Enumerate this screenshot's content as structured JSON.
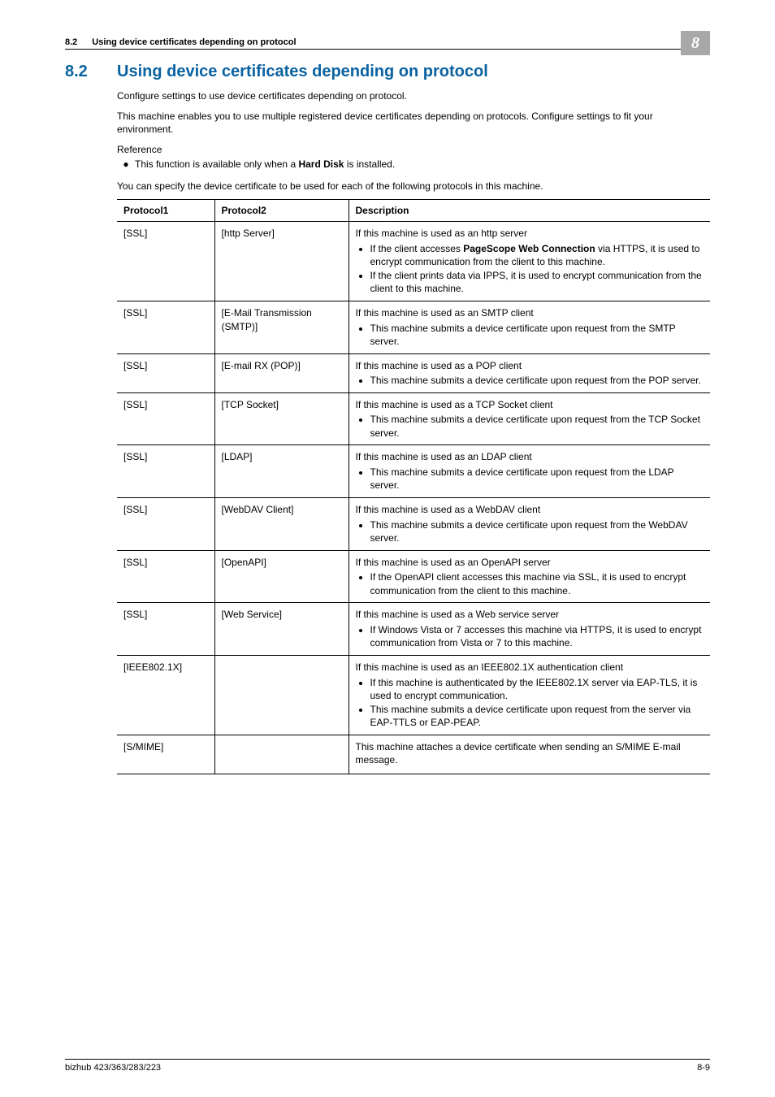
{
  "header": {
    "section_number": "8.2",
    "running_title": "Using device certificates depending on protocol",
    "chapter_number": "8"
  },
  "section": {
    "number": "8.2",
    "title": "Using device certificates depending on protocol",
    "intro1": "Configure settings to use device certificates depending on protocol.",
    "intro2": "This machine enables you to use multiple registered device certificates depending on protocols. Configure settings to fit your environment.",
    "reference_label": "Reference",
    "reference_bullet_prefix": "This function is available only when a ",
    "reference_bullet_bold": "Hard Disk",
    "reference_bullet_suffix": " is installed.",
    "lead_in": "You can specify the device certificate to be used for each of the following protocols in this machine."
  },
  "table": {
    "headers": {
      "p1": "Protocol1",
      "p2": "Protocol2",
      "desc": "Description"
    },
    "rows": [
      {
        "p1": "[SSL]",
        "p2": "[http Server]",
        "intro": "If this machine is used as an http server",
        "bullets": [
          {
            "pre": "If the client accesses ",
            "bold": "PageScope Web Connection",
            "post": " via HTTPS, it is used to encrypt communication from the client to this machine."
          },
          {
            "pre": "If the client prints data via IPPS, it is used to encrypt communication from the client to this machine.",
            "bold": "",
            "post": ""
          }
        ]
      },
      {
        "p1": "[SSL]",
        "p2": "[E-Mail Transmission (SMTP)]",
        "intro": "If this machine is used as an SMTP client",
        "bullets": [
          {
            "pre": "This machine submits a device certificate upon request from the SMTP server.",
            "bold": "",
            "post": ""
          }
        ]
      },
      {
        "p1": "[SSL]",
        "p2": "[E-mail RX (POP)]",
        "intro": "If this machine is used as a POP client",
        "bullets": [
          {
            "pre": "This machine submits a device certificate upon request from the POP server.",
            "bold": "",
            "post": ""
          }
        ]
      },
      {
        "p1": "[SSL]",
        "p2": "[TCP Socket]",
        "intro": "If this machine is used as a TCP Socket client",
        "bullets": [
          {
            "pre": "This machine submits a device certificate upon request from the TCP Socket server.",
            "bold": "",
            "post": ""
          }
        ]
      },
      {
        "p1": "[SSL]",
        "p2": "[LDAP]",
        "intro": "If this machine is used as an LDAP client",
        "bullets": [
          {
            "pre": "This machine submits a device certificate upon request from the LDAP server.",
            "bold": "",
            "post": ""
          }
        ]
      },
      {
        "p1": "[SSL]",
        "p2": "[WebDAV Client]",
        "intro": "If this machine is used as a WebDAV client",
        "bullets": [
          {
            "pre": "This machine submits a device certificate upon request from the WebDAV server.",
            "bold": "",
            "post": ""
          }
        ]
      },
      {
        "p1": "[SSL]",
        "p2": "[OpenAPI]",
        "intro": "If this machine is used as an OpenAPI server",
        "bullets": [
          {
            "pre": "If the OpenAPI client accesses this machine via SSL, it is used to encrypt communication from the client to this machine.",
            "bold": "",
            "post": ""
          }
        ]
      },
      {
        "p1": "[SSL]",
        "p2": "[Web Service]",
        "intro": "If this machine is used as a Web service server",
        "bullets": [
          {
            "pre": "If Windows Vista or 7 accesses this machine via HTTPS, it is used to encrypt communication from Vista or 7 to this machine.",
            "bold": "",
            "post": ""
          }
        ]
      },
      {
        "p1": "[IEEE802.1X]",
        "p2": "",
        "intro": "If this machine is used as an IEEE802.1X authentication client",
        "bullets": [
          {
            "pre": "If this machine is authenticated by the IEEE802.1X server via EAP-TLS, it is used to encrypt communication.",
            "bold": "",
            "post": ""
          },
          {
            "pre": "This machine submits a device certificate upon request from the server via EAP-TTLS or EAP-PEAP.",
            "bold": "",
            "post": ""
          }
        ]
      },
      {
        "p1": "[S/MIME]",
        "p2": "",
        "intro": "This machine attaches a device certificate when sending an S/MIME E-mail message.",
        "bullets": []
      }
    ]
  },
  "footer": {
    "product": "bizhub 423/363/283/223",
    "page": "8-9"
  }
}
